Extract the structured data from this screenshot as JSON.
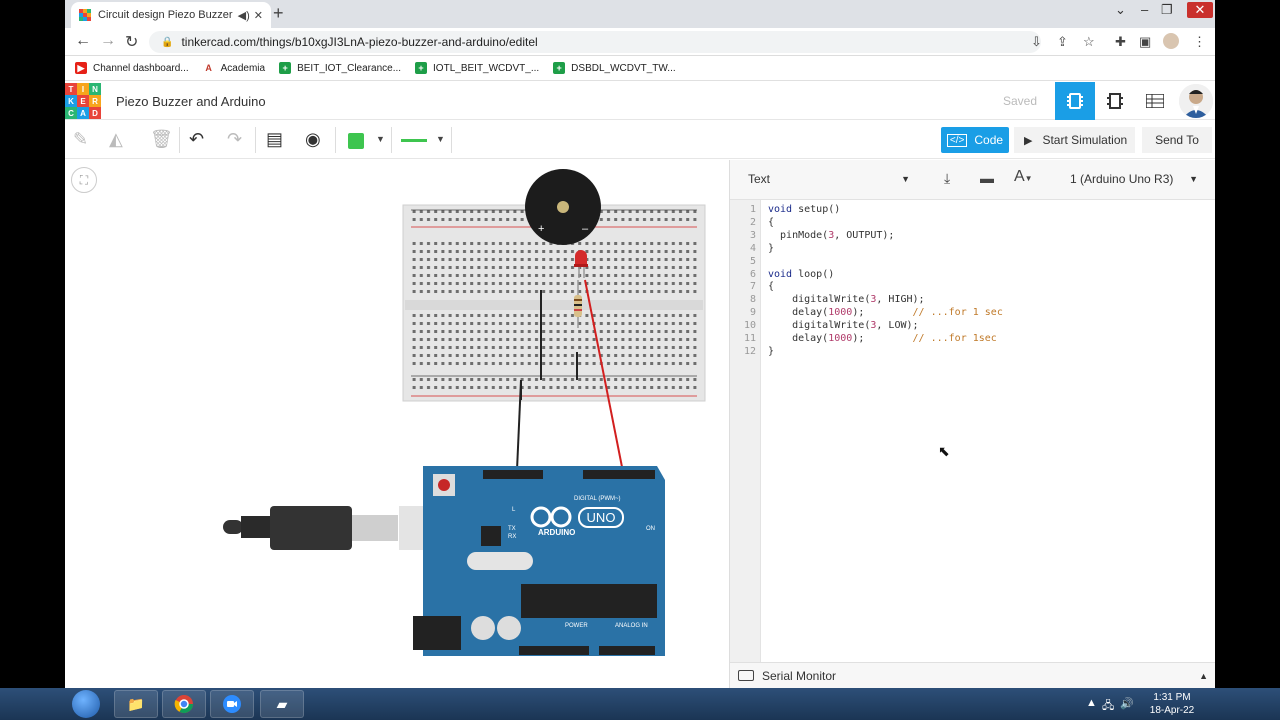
{
  "browser": {
    "tab_title": "Circuit design Piezo Buzzer a",
    "url": "tinkercad.com/things/b10xgJI3LnA-piezo-buzzer-and-arduino/editel",
    "bookmarks": [
      {
        "label": "Channel dashboard...",
        "color": "#e62117",
        "glyph": "▶"
      },
      {
        "label": "Academia",
        "color": "#c0392b",
        "glyph": "A"
      },
      {
        "label": "BEIT_IOT_Clearance...",
        "color": "#1e9e48",
        "glyph": "+"
      },
      {
        "label": "IOTL_BEIT_WCDVT_...",
        "color": "#1e9e48",
        "glyph": "+"
      },
      {
        "label": "DSBDL_WCDVT_TW...",
        "color": "#1e9e48",
        "glyph": "+"
      }
    ]
  },
  "app": {
    "logo_letters": [
      "TIN",
      "KER",
      "CAD"
    ],
    "logo_colors": [
      "#e8443a",
      "#f7a51c",
      "#2bb673",
      "#1a9ee6"
    ],
    "design_title": "Piezo Buzzer and Arduino",
    "saved_label": "Saved",
    "accent_color": "#1a9ee6"
  },
  "toolbar": {
    "code_label": "Code",
    "simulate_label": "Start Simulation",
    "send_label": "Send To",
    "wire_color": "#3ec54f"
  },
  "code_panel": {
    "mode": "Text",
    "device": "1 (Arduino Uno R3)",
    "serial_label": "Serial Monitor",
    "lines": [
      [
        {
          "t": "void",
          "c": "kw"
        },
        {
          "t": " setup()",
          "c": ""
        }
      ],
      [
        {
          "t": "{",
          "c": ""
        }
      ],
      [
        {
          "t": "  pinMode(",
          "c": ""
        },
        {
          "t": "3",
          "c": "num"
        },
        {
          "t": ", OUTPUT);",
          "c": ""
        }
      ],
      [
        {
          "t": "}",
          "c": ""
        }
      ],
      [],
      [
        {
          "t": "void",
          "c": "kw"
        },
        {
          "t": " loop()",
          "c": ""
        }
      ],
      [
        {
          "t": "{",
          "c": ""
        }
      ],
      [
        {
          "t": "    digitalWrite(",
          "c": ""
        },
        {
          "t": "3",
          "c": "num"
        },
        {
          "t": ", HIGH);",
          "c": ""
        }
      ],
      [
        {
          "t": "    delay(",
          "c": ""
        },
        {
          "t": "1000",
          "c": "num"
        },
        {
          "t": ");        ",
          "c": ""
        },
        {
          "t": "// ...for 1 sec",
          "c": "com"
        }
      ],
      [
        {
          "t": "    digitalWrite(",
          "c": ""
        },
        {
          "t": "3",
          "c": "num"
        },
        {
          "t": ", LOW);",
          "c": ""
        }
      ],
      [
        {
          "t": "    delay(",
          "c": ""
        },
        {
          "t": "1000",
          "c": "num"
        },
        {
          "t": ");        ",
          "c": ""
        },
        {
          "t": "// ...for 1sec",
          "c": "com"
        }
      ],
      [
        {
          "t": "}",
          "c": ""
        }
      ]
    ]
  },
  "circuit": {
    "board_brand": "ARDUINO",
    "board_model": "UNO",
    "digital_label": "DIGITAL (PWM~)",
    "power_label": "POWER",
    "analog_label": "ANALOG IN",
    "on_label": "ON",
    "tx_label": "TX",
    "rx_label": "RX",
    "l_label": "L",
    "buzzer_plus": "+",
    "buzzer_minus": "–"
  },
  "taskbar": {
    "time": "1:31 PM",
    "date": "18-Apr-22"
  }
}
